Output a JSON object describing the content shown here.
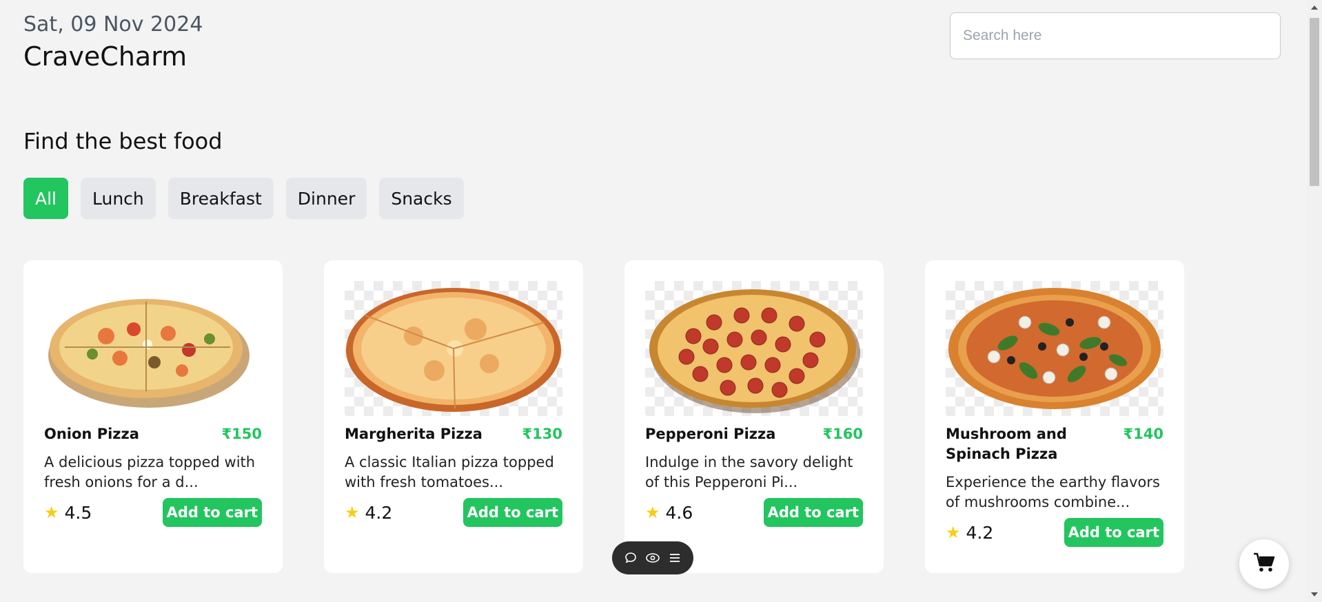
{
  "header": {
    "date": "Sat, 09 Nov 2024",
    "brand": "CraveCharm",
    "search_placeholder": "Search here"
  },
  "main": {
    "heading": "Find the best food",
    "categories": [
      {
        "label": "All",
        "active": true
      },
      {
        "label": "Lunch",
        "active": false
      },
      {
        "label": "Breakfast",
        "active": false
      },
      {
        "label": "Dinner",
        "active": false
      },
      {
        "label": "Snacks",
        "active": false
      }
    ],
    "items": [
      {
        "name": "Onion Pizza",
        "price": "₹150",
        "description": "A delicious pizza topped with fresh onions for a d...",
        "rating": "4.5",
        "button": "Add to cart",
        "image": "onion-pizza-image"
      },
      {
        "name": "Margherita Pizza",
        "price": "₹130",
        "description": "A classic Italian pizza topped with fresh tomatoes...",
        "rating": "4.2",
        "button": "Add to cart",
        "image": "margherita-pizza-image"
      },
      {
        "name": "Pepperoni Pizza",
        "price": "₹160",
        "description": "Indulge in the savory delight of this Pepperoni Pi...",
        "rating": "4.6",
        "button": "Add to cart",
        "image": "pepperoni-pizza-image"
      },
      {
        "name": "Mushroom and Spinach Pizza",
        "price": "₹140",
        "description": "Experience the earthy flavors of mushrooms combine...",
        "rating": "4.2",
        "button": "Add to cart",
        "image": "mushroom-spinach-pizza-image"
      }
    ]
  },
  "toolbar": {
    "icons": [
      "comment-icon",
      "eye-icon",
      "menu-icon"
    ]
  },
  "cart_fab": {
    "icon": "cart-icon"
  },
  "colors": {
    "accent": "#22c55e",
    "star": "#facc15",
    "background": "#f3f3f3",
    "chip": "#e5e7eb"
  }
}
